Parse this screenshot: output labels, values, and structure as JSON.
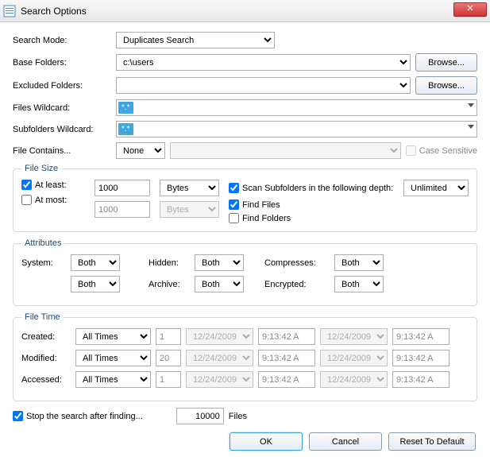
{
  "window": {
    "title": "Search Options",
    "close": "✕"
  },
  "labels": {
    "searchMode": "Search Mode:",
    "baseFolders": "Base Folders:",
    "excludedFolders": "Excluded Folders:",
    "filesWildcard": "Files Wildcard:",
    "subfoldersWildcard": "Subfolders Wildcard:",
    "fileContains": "File Contains...",
    "caseSensitive": "Case Sensitive",
    "browse": "Browse..."
  },
  "values": {
    "searchMode": "Duplicates Search",
    "baseFolders": "c:\\users",
    "excludedFolders": "",
    "wildcardTag": "*.*",
    "containsMode": "None",
    "containsText": ""
  },
  "fileSize": {
    "legend": "File Size",
    "atLeast": "At least:",
    "atMost": "At most:",
    "atLeastVal": "1000",
    "atMostVal": "1000",
    "atLeastUnit": "Bytes",
    "atMostUnit": "Bytes",
    "atLeastChecked": true,
    "atMostChecked": false
  },
  "scanOptions": {
    "scanSubfolders": "Scan Subfolders in the following depth:",
    "findFiles": "Find Files",
    "findFolders": "Find Folders",
    "depth": "Unlimited",
    "scanChecked": true,
    "filesChecked": true,
    "foldersChecked": false
  },
  "attributes": {
    "legend": "Attributes",
    "system": "System:",
    "hidden": "Hidden:",
    "archive": "Archive:",
    "compresses": "Compresses:",
    "encrypted": "Encrypted:",
    "both": "Both"
  },
  "fileTime": {
    "legend": "File Time",
    "created": "Created:",
    "modified": "Modified:",
    "accessed": "Accessed:",
    "allTimes": "All Times",
    "n1": "1",
    "n20": "20",
    "date": "12/24/2009",
    "time": "9:13:42 A"
  },
  "bottom": {
    "stopAfter": "Stop the search after finding...",
    "count": "10000",
    "files": "Files",
    "checked": true
  },
  "buttons": {
    "ok": "OK",
    "cancel": "Cancel",
    "reset": "Reset To Default"
  }
}
